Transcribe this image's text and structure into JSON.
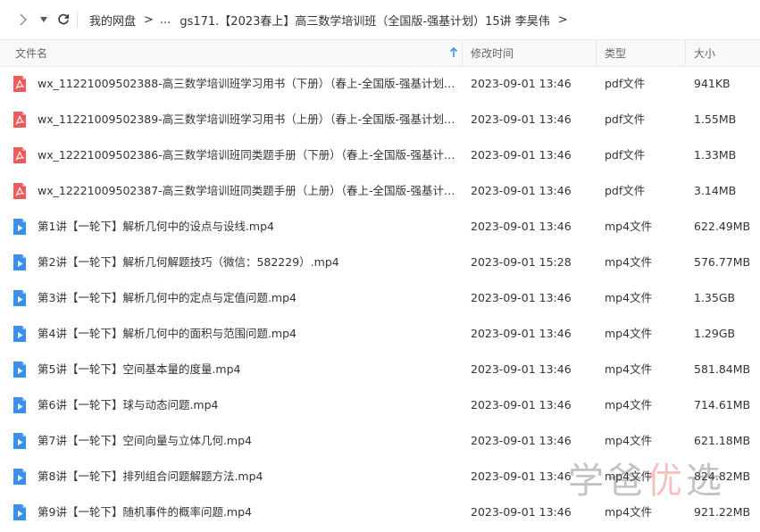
{
  "breadcrumb": {
    "items": [
      "我的网盘",
      "...",
      "gs171.【2023春上】高三数学培训班（全国版-强基计划）15讲 李昊伟"
    ],
    "separator": ">"
  },
  "header": {
    "name": "文件名",
    "time": "修改时间",
    "type": "类型",
    "size": "大小"
  },
  "colors": {
    "pdf": "#f05a5a",
    "mp4": "#3a8ff0",
    "sort_arrow": "#3a8ff0"
  },
  "files": [
    {
      "icon": "pdf-icon",
      "name": "wx_11221009502388-高三数学培训班学习用书（下册）（春上-全国版-强基计划）-...",
      "time": "2023-09-01 13:46",
      "type": "pdf文件",
      "size": "941KB"
    },
    {
      "icon": "pdf-icon",
      "name": "wx_11221009502389-高三数学培训班学习用书（上册）（春上-全国版-强基计划）-...",
      "time": "2023-09-01 13:46",
      "type": "pdf文件",
      "size": "1.55MB"
    },
    {
      "icon": "pdf-icon",
      "name": "wx_12221009502386-高三数学培训班同类题手册（下册）（春上-全国版-强基计划）...",
      "time": "2023-09-01 13:46",
      "type": "pdf文件",
      "size": "1.33MB"
    },
    {
      "icon": "pdf-icon",
      "name": "wx_12221009502387-高三数学培训班同类题手册（上册）（春上-全国版-强基计划）...",
      "time": "2023-09-01 13:46",
      "type": "pdf文件",
      "size": "3.14MB"
    },
    {
      "icon": "video-icon",
      "name": "第1讲【一轮下】解析几何中的设点与设线.mp4",
      "time": "2023-09-01 13:46",
      "type": "mp4文件",
      "size": "622.49MB"
    },
    {
      "icon": "video-icon",
      "name": "第2讲【一轮下】解析几何解题技巧（微信：582229）.mp4",
      "time": "2023-09-01 15:28",
      "type": "mp4文件",
      "size": "576.77MB"
    },
    {
      "icon": "video-icon",
      "name": "第3讲【一轮下】解析几何中的定点与定值问题.mp4",
      "time": "2023-09-01 13:46",
      "type": "mp4文件",
      "size": "1.35GB"
    },
    {
      "icon": "video-icon",
      "name": "第4讲【一轮下】解析几何中的面积与范围问题.mp4",
      "time": "2023-09-01 13:46",
      "type": "mp4文件",
      "size": "1.29GB"
    },
    {
      "icon": "video-icon",
      "name": "第5讲【一轮下】空间基本量的度量.mp4",
      "time": "2023-09-01 13:46",
      "type": "mp4文件",
      "size": "581.84MB"
    },
    {
      "icon": "video-icon",
      "name": "第6讲【一轮下】球与动态问题.mp4",
      "time": "2023-09-01 13:46",
      "type": "mp4文件",
      "size": "714.61MB"
    },
    {
      "icon": "video-icon",
      "name": "第7讲【一轮下】空间向量与立体几何.mp4",
      "time": "2023-09-01 13:46",
      "type": "mp4文件",
      "size": "621.18MB"
    },
    {
      "icon": "video-icon",
      "name": "第8讲【一轮下】排列组合问题解题方法.mp4",
      "time": "2023-09-01 13:46",
      "type": "mp4文件",
      "size": "824.82MB"
    },
    {
      "icon": "video-icon",
      "name": "第9讲【一轮下】随机事件的概率问题.mp4",
      "time": "2023-09-01 13:46",
      "type": "mp4文件",
      "size": "921.22MB"
    }
  ],
  "watermark": {
    "chars": [
      "学",
      "爸",
      "优",
      "选"
    ]
  }
}
